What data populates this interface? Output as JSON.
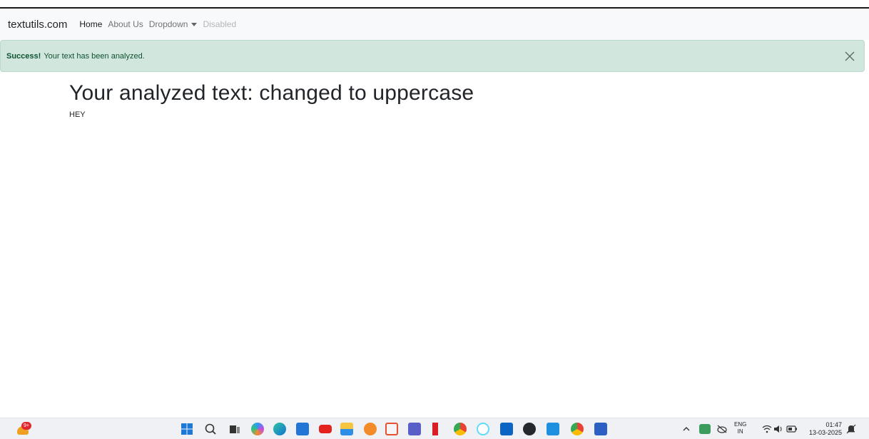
{
  "navbar": {
    "brand": "textutils.com",
    "links": [
      {
        "label": "Home",
        "state": "active"
      },
      {
        "label": "About Us",
        "state": "normal"
      },
      {
        "label": "Dropdown",
        "state": "normal"
      },
      {
        "label": "Disabled",
        "state": "disabled"
      }
    ]
  },
  "alert": {
    "strong": "Success!",
    "message": "Your text has been analyzed.",
    "background": "#d1e7dd"
  },
  "main": {
    "heading": "Your analyzed text: changed to uppercase",
    "result": "HEY"
  },
  "taskbar": {
    "weather_badge": "9+",
    "tray_lang_top": "ENG",
    "tray_lang_bottom": "IN",
    "time": "01:47",
    "date": "13-03-2025",
    "icons": [
      "windows-start-icon",
      "search-icon",
      "task-view-icon",
      "copilot-icon",
      "edge-icon",
      "store-icon",
      "youtube-icon",
      "file-explorer-icon",
      "app-icon",
      "xampp-icon",
      "teams-icon",
      "netflix-icon",
      "chrome-icon",
      "react-icon",
      "linkedin-icon",
      "github-icon",
      "vscode-icon",
      "chrome-profile-icon",
      "powershell-icon"
    ]
  }
}
